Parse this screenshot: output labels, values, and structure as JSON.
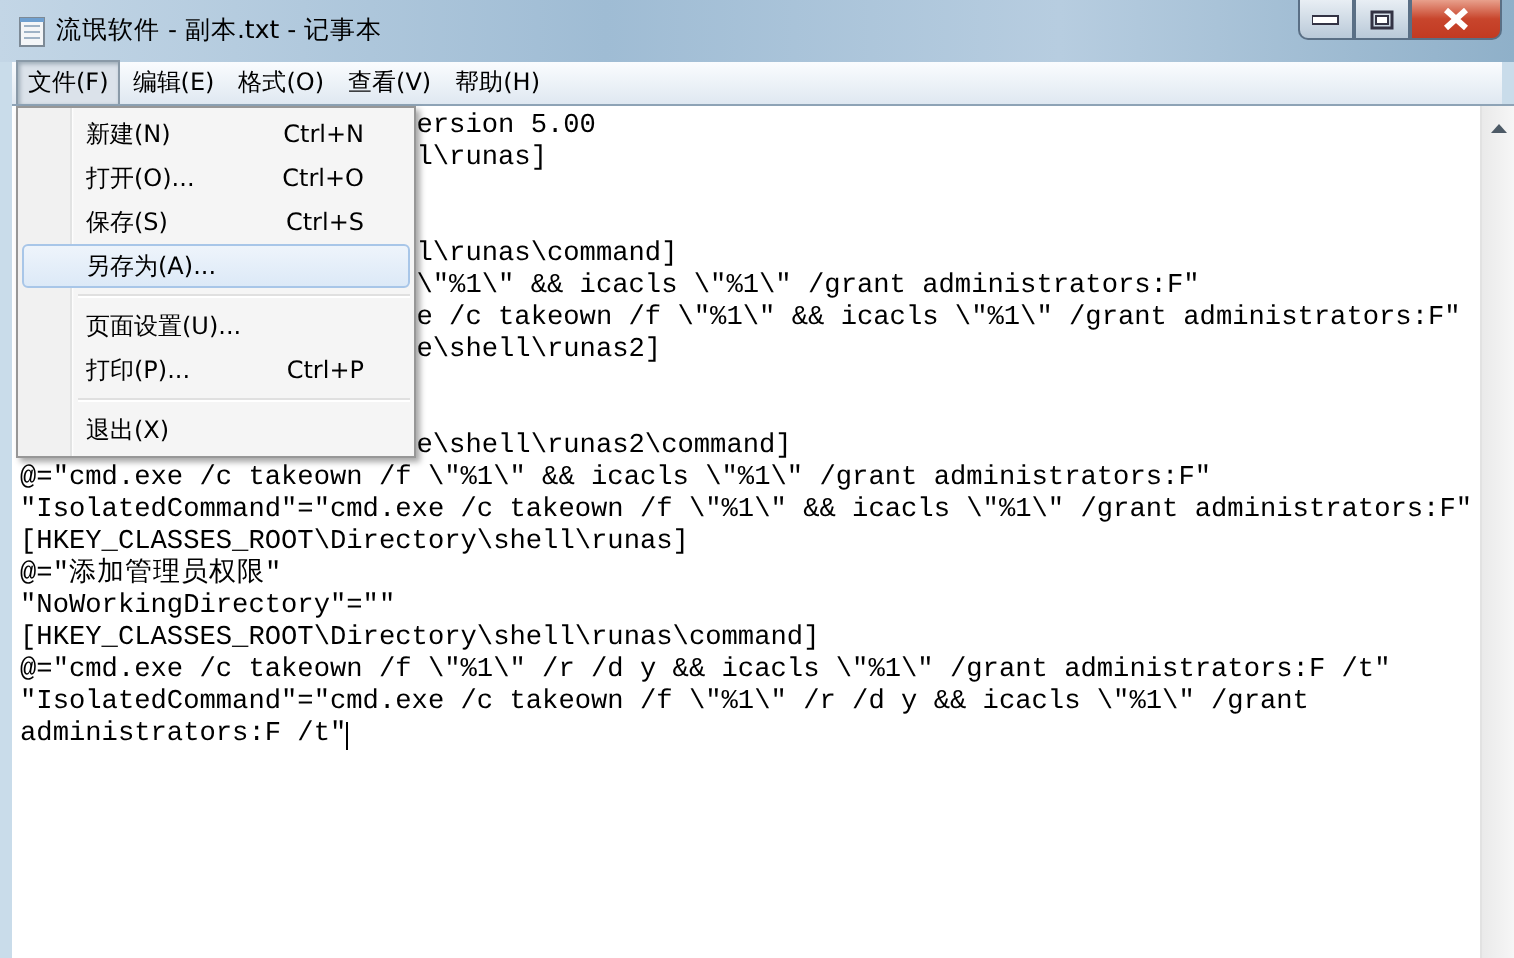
{
  "window": {
    "title": "流氓软件 - 副本.txt - 记事本"
  },
  "menu_bar": [
    {
      "label": "文件(F)",
      "selected": true
    },
    {
      "label": "编辑(E)",
      "selected": false
    },
    {
      "label": "格式(O)",
      "selected": false
    },
    {
      "label": "查看(V)",
      "selected": false
    },
    {
      "label": "帮助(H)",
      "selected": false
    }
  ],
  "file_menu": [
    {
      "kind": "item",
      "label": "新建(N)",
      "shortcut": "Ctrl+N",
      "selected": false
    },
    {
      "kind": "item",
      "label": "打开(O)...",
      "shortcut": "Ctrl+O",
      "selected": false
    },
    {
      "kind": "item",
      "label": "保存(S)",
      "shortcut": "Ctrl+S",
      "selected": false
    },
    {
      "kind": "item",
      "label": "另存为(A)...",
      "selected": true
    },
    {
      "kind": "separator"
    },
    {
      "kind": "item",
      "label": "页面设置(U)...",
      "selected": false
    },
    {
      "kind": "item",
      "label": "打印(P)...",
      "shortcut": "Ctrl+P",
      "selected": false
    },
    {
      "kind": "separator"
    },
    {
      "kind": "item",
      "label": "退出(X)",
      "selected": false
    }
  ],
  "editor_lines": [
    {
      "kind": "tail",
      "text": "ersion 5.00"
    },
    {
      "kind": "tail",
      "text": "l\\runas]"
    },
    {
      "kind": "blank"
    },
    {
      "kind": "blank"
    },
    {
      "kind": "tail",
      "text": "l\\runas\\command]"
    },
    {
      "kind": "tail",
      "text": "\\\"%1\\\" && icacls \\\"%1\\\" /grant administrators:F\""
    },
    {
      "kind": "tail",
      "text": "e /c takeown /f \\\"%1\\\" && icacls \\\"%1\\\" /grant administrators:F\""
    },
    {
      "kind": "tail",
      "text": "e\\shell\\runas2]"
    },
    {
      "kind": "blank"
    },
    {
      "kind": "blank"
    },
    {
      "kind": "tail",
      "text": "e\\shell\\runas2\\command]"
    },
    {
      "kind": "full",
      "text": "@=\"cmd.exe /c takeown /f \\\"%1\\\" && icacls \\\"%1\\\" /grant administrators:F\""
    },
    {
      "kind": "full",
      "text": "\"IsolatedCommand\"=\"cmd.exe /c takeown /f \\\"%1\\\" && icacls \\\"%1\\\" /grant administrators:F\""
    },
    {
      "kind": "full",
      "text": "[HKEY_CLASSES_ROOT\\Directory\\shell\\runas]"
    },
    {
      "kind": "full",
      "text": "@=\"添加管理员权限\""
    },
    {
      "kind": "full",
      "text": "\"NoWorkingDirectory\"=\"\""
    },
    {
      "kind": "full",
      "text": "[HKEY_CLASSES_ROOT\\Directory\\shell\\runas\\command]"
    },
    {
      "kind": "full",
      "text": "@=\"cmd.exe /c takeown /f \\\"%1\\\" /r /d y && icacls \\\"%1\\\" /grant administrators:F /t\""
    },
    {
      "kind": "full",
      "text": "\"IsolatedCommand\"=\"cmd.exe /c takeown /f \\\"%1\\\" /r /d y && icacls \\\"%1\\\" /grant"
    },
    {
      "kind": "full",
      "text": "administrators:F /t\"",
      "caret": true
    }
  ]
}
